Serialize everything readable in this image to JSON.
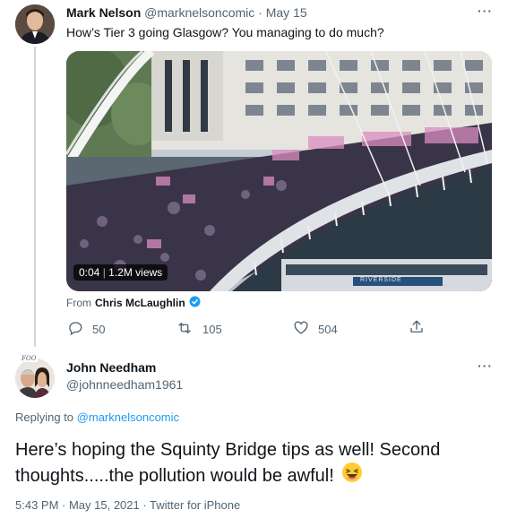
{
  "tweet1": {
    "author_name": "Mark Nelson",
    "handle": "@marknelsoncomic",
    "separator": "·",
    "date": "May 15",
    "text": "How’s Tier 3 going Glasgow? You managing to do much?",
    "video": {
      "duration": "0:04",
      "views": "1.2M views",
      "sign_text": "RIVERSIDE"
    },
    "from_prefix": "From",
    "from_name": "Chris McLaughlin",
    "stats": {
      "replies": "50",
      "retweets": "105",
      "likes": "504"
    }
  },
  "tweet2": {
    "author_name": "John Needham",
    "handle": "@johnneedham1961",
    "avatar_badge": "FOO",
    "replying_prefix": "Replying to",
    "replying_handle": "@marknelsoncomic",
    "text_line1": "Here’s hoping the Squinty Bridge tips as well! Second",
    "text_line2": "thoughts.....the pollution would be awful!",
    "meta": "5:43 PM · May 15, 2021 · Twitter for iPhone"
  },
  "icons": {
    "more": "more-icon",
    "verified": "verified-badge-icon",
    "reply": "reply-icon",
    "retweet": "retweet-icon",
    "like": "like-icon",
    "share": "share-icon",
    "emoji": "laughing-emoji-icon"
  },
  "colors": {
    "accent": "#1d9bf0",
    "muted": "#536471",
    "text": "#0f1419",
    "crowd_pink": "#d98cc0"
  }
}
